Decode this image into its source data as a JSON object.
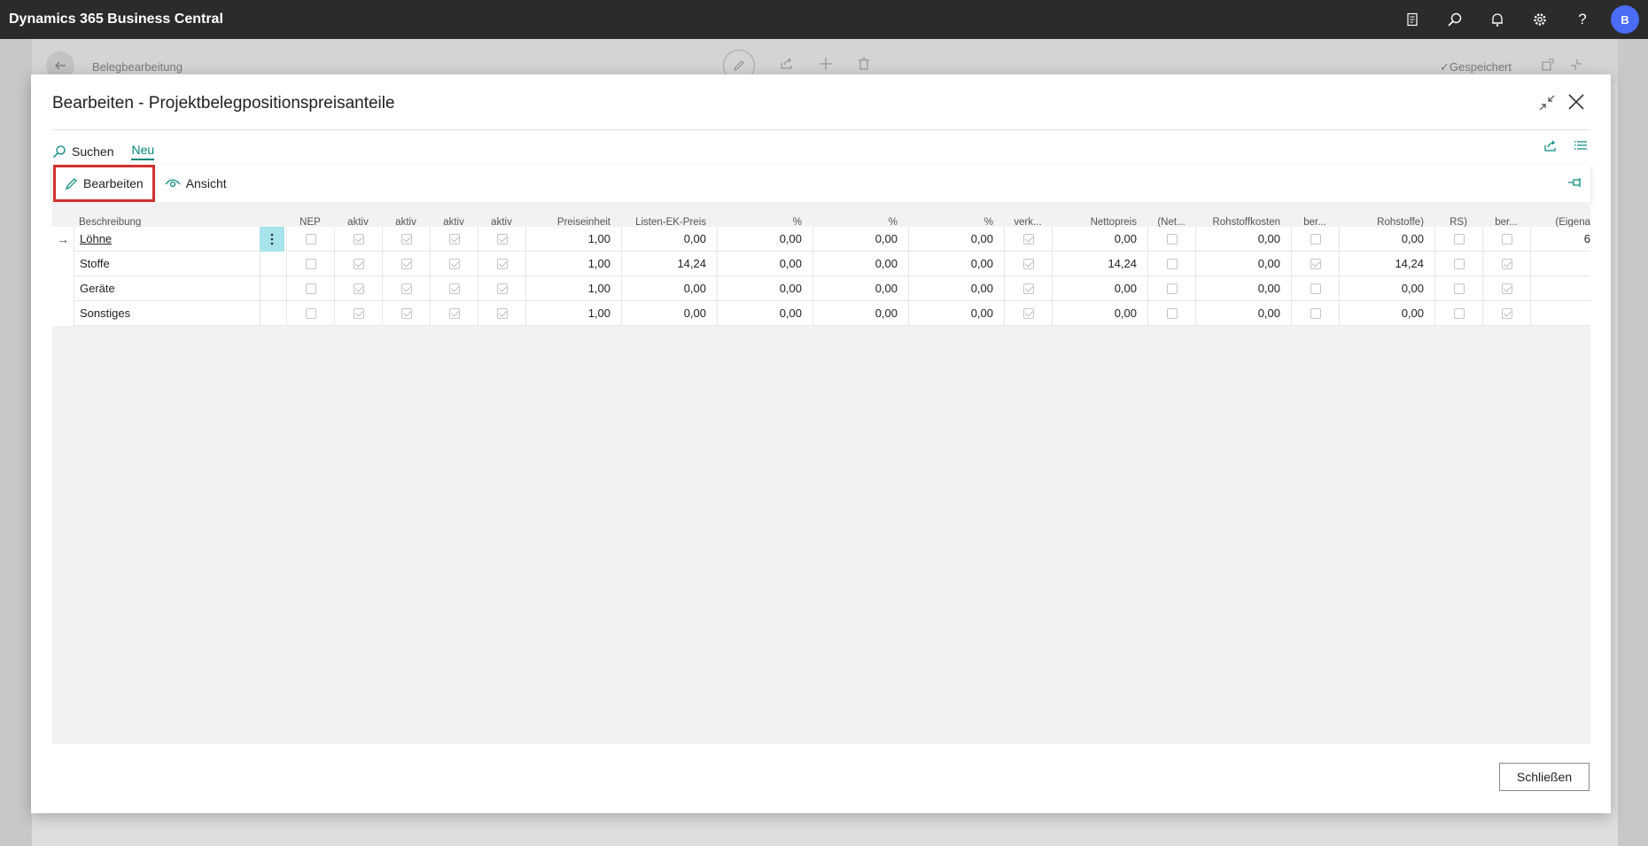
{
  "app": {
    "title": "Dynamics 365 Business Central",
    "avatar_initial": "B",
    "icons": [
      "document-icon",
      "search-icon",
      "bell-icon",
      "gear-icon",
      "help-icon"
    ]
  },
  "background_page": {
    "title": "Belegbearbeitung",
    "status": "Gespeichert"
  },
  "dialog": {
    "title": "Bearbeiten - Projektbelegpositionspreisanteile",
    "close_label": "Schließen",
    "subnav": {
      "search_label": "Suchen",
      "new_label": "Neu"
    },
    "actions": {
      "edit_label": "Bearbeiten",
      "view_label": "Ansicht"
    },
    "columns": [
      {
        "key": "desc",
        "label1": "",
        "label2": "Beschreibung"
      },
      {
        "key": "nep",
        "label1": "",
        "label2": "NEP"
      },
      {
        "key": "c1",
        "label1": "",
        "label2": "aktiv"
      },
      {
        "key": "c2",
        "label1": "",
        "label2": "aktiv"
      },
      {
        "key": "c3",
        "label1": "",
        "label2": "aktiv"
      },
      {
        "key": "c4",
        "label1": "",
        "label2": "aktiv"
      },
      {
        "key": "preiseinheit",
        "label1": "",
        "label2": "Preiseinheit"
      },
      {
        "key": "listenek",
        "label1": "",
        "label2": "Listen-EK-Preis"
      },
      {
        "key": "p1",
        "label1": "",
        "label2": "%"
      },
      {
        "key": "p2",
        "label1": "",
        "label2": "%"
      },
      {
        "key": "p3",
        "label1": "",
        "label2": "%"
      },
      {
        "key": "verk",
        "label1": "",
        "label2": "verk..."
      },
      {
        "key": "netto",
        "label1": "",
        "label2": "Nettopreis"
      },
      {
        "key": "net",
        "label1": "",
        "label2": "(Net..."
      },
      {
        "key": "rohstoff",
        "label1": "",
        "label2": "Rohstoffkosten"
      },
      {
        "key": "ber1",
        "label1": "",
        "label2": "ber..."
      },
      {
        "key": "rohstoffe",
        "label1": "",
        "label2": "Rohstoffe)"
      },
      {
        "key": "rs",
        "label1": "",
        "label2": "RS)"
      },
      {
        "key": "ber2",
        "label1": "",
        "label2": "ber..."
      },
      {
        "key": "eigen",
        "label1": "",
        "label2": "(Eigena"
      }
    ],
    "rows": [
      {
        "desc": "Löhne",
        "nep": false,
        "c1": true,
        "c2": true,
        "c3": true,
        "c4": true,
        "preiseinheit": "1,00",
        "listenek": "0,00",
        "p1": "0,00",
        "p2": "0,00",
        "p3": "0,00",
        "verk": true,
        "netto": "0,00",
        "net": false,
        "rohstoff": "0,00",
        "ber1": false,
        "rohstoffe": "0,00",
        "rs": false,
        "ber2": false,
        "eigen": "6",
        "selected": true
      },
      {
        "desc": "Stoffe",
        "nep": false,
        "c1": true,
        "c2": true,
        "c3": true,
        "c4": true,
        "preiseinheit": "1,00",
        "listenek": "14,24",
        "p1": "0,00",
        "p2": "0,00",
        "p3": "0,00",
        "verk": true,
        "netto": "14,24",
        "net": false,
        "rohstoff": "0,00",
        "ber1": true,
        "rohstoffe": "14,24",
        "rs": false,
        "ber2": true,
        "eigen": ""
      },
      {
        "desc": "Geräte",
        "nep": false,
        "c1": true,
        "c2": true,
        "c3": true,
        "c4": true,
        "preiseinheit": "1,00",
        "listenek": "0,00",
        "p1": "0,00",
        "p2": "0,00",
        "p3": "0,00",
        "verk": true,
        "netto": "0,00",
        "net": false,
        "rohstoff": "0,00",
        "ber1": false,
        "rohstoffe": "0,00",
        "rs": false,
        "ber2": true,
        "eigen": ""
      },
      {
        "desc": "Sonstiges",
        "nep": false,
        "c1": true,
        "c2": true,
        "c3": true,
        "c4": true,
        "preiseinheit": "1,00",
        "listenek": "0,00",
        "p1": "0,00",
        "p2": "0,00",
        "p3": "0,00",
        "verk": true,
        "netto": "0,00",
        "net": false,
        "rohstoff": "0,00",
        "ber1": false,
        "rohstoffe": "0,00",
        "rs": false,
        "ber2": true,
        "eigen": ""
      }
    ],
    "horizontal_scroll_fraction": 0.46
  },
  "colors": {
    "appbar": "#2b2b2b",
    "accent": "#00857a",
    "highlight_box": "#d32f2f",
    "selected_menu_cell": "#a6e3ea",
    "avatar": "#4a6cf7"
  }
}
